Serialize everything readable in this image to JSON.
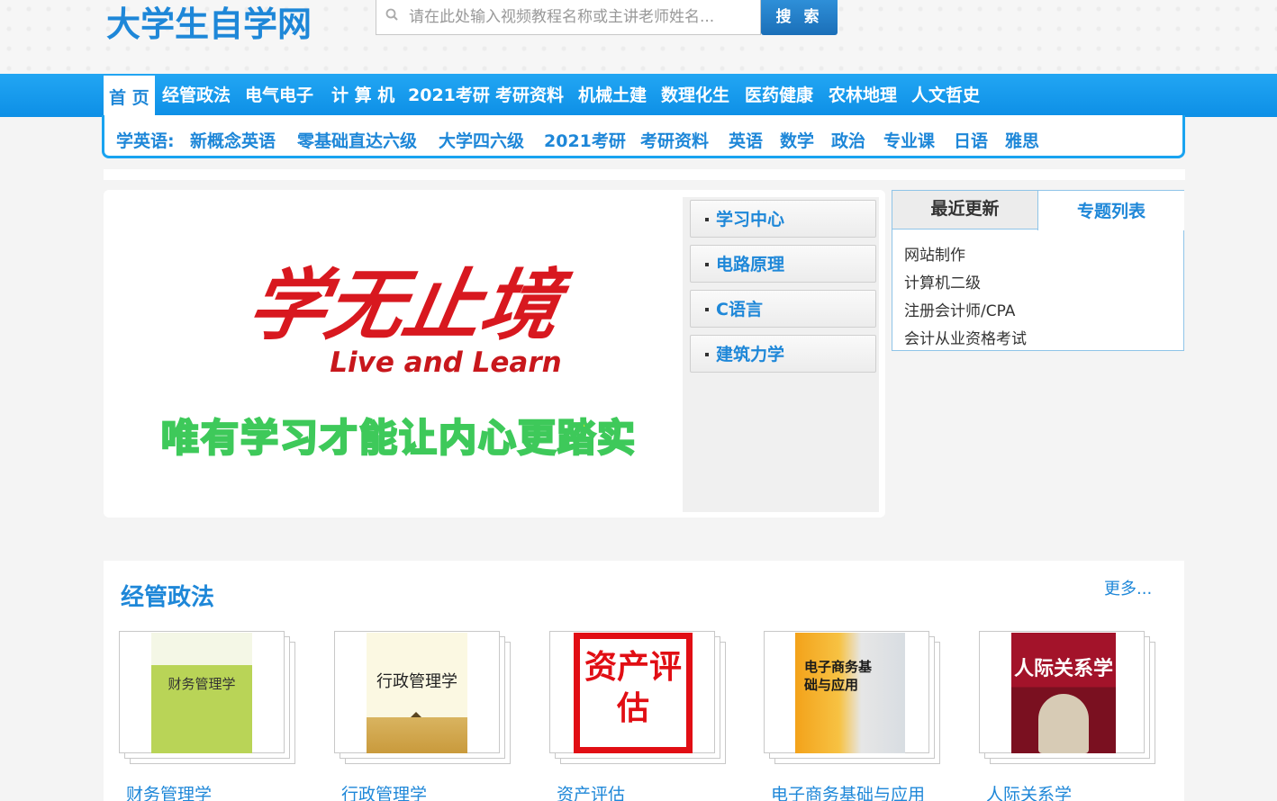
{
  "header": {
    "logo_text": "大学生自学网",
    "search_placeholder": "请在此处输入视频教程名称或主讲老师姓名...",
    "search_button": "搜 索"
  },
  "nav": {
    "items": [
      "首 页",
      "经管政法",
      "电气电子",
      "计 算 机",
      "2021考研",
      "考研资料",
      "机械土建",
      "数理化生",
      "医药健康",
      "农林地理",
      "人文哲史"
    ]
  },
  "sub_nav": {
    "items": [
      "学英语:",
      "新概念英语",
      "零基础直达六级",
      "大学四六级",
      "2021考研",
      "考研资料",
      "英语",
      "数学",
      "政治",
      "专业课",
      "日语",
      "雅思"
    ]
  },
  "banner": {
    "headline": "学无止境",
    "subline": "Live and Learn",
    "motto": "唯有学习才能让内心更踏实"
  },
  "side_tabs": [
    "学习中心",
    "电路原理",
    "C语言",
    "建筑力学"
  ],
  "right_panel": {
    "tab_recent": "最近更新",
    "tab_topics": "专题列表",
    "topics": [
      "网站制作",
      "计算机二级",
      "注册会计师/CPA",
      "会计从业资格考试"
    ]
  },
  "section": {
    "title": "经管政法",
    "more": "更多...",
    "books": [
      {
        "title": "财务管理学",
        "cover_text": "财务管理学"
      },
      {
        "title": "行政管理学",
        "cover_text": "行政管理学"
      },
      {
        "title": "资产评估",
        "cover_text": "资产评估"
      },
      {
        "title": "电子商务基础与应用",
        "cover_text": "电子商务基础与应用"
      },
      {
        "title": "人际关系学",
        "cover_text": "人际关系学"
      }
    ]
  }
}
